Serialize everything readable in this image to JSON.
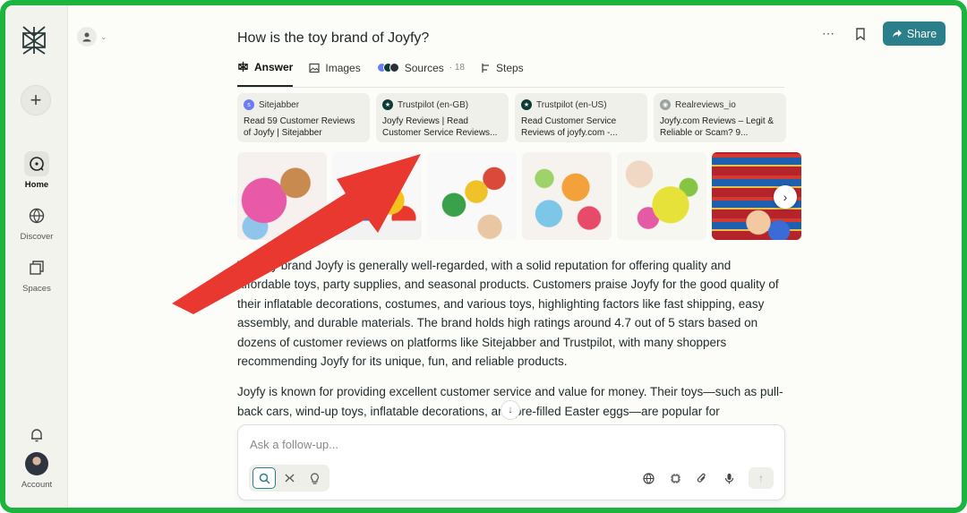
{
  "colors": {
    "frame": "#1cb33e",
    "accent": "#2a7f8a",
    "arrow": "#e8382f"
  },
  "sidebar": {
    "items": [
      {
        "label": "Home",
        "icon": "home-icon",
        "active": true
      },
      {
        "label": "Discover",
        "icon": "globe-icon",
        "active": false
      },
      {
        "label": "Spaces",
        "icon": "spaces-icon",
        "active": false
      }
    ],
    "account_label": "Account"
  },
  "header": {
    "title": "How is the toy brand of Joyfy?",
    "share_label": "Share"
  },
  "tabs": [
    {
      "label": "Answer",
      "icon": "answer-icon",
      "active": true
    },
    {
      "label": "Images",
      "icon": "image-icon",
      "active": false
    },
    {
      "label": "Sources",
      "icon": "sources-icon",
      "active": false,
      "count": "· 18"
    },
    {
      "label": "Steps",
      "icon": "steps-icon",
      "active": false
    }
  ],
  "sources": [
    {
      "site": "Sitejabber",
      "title": "Read 59 Customer Reviews of Joyfy | Sitejabber",
      "favicon": "sitejabber-icon",
      "favicon_color": "#6b7cf5"
    },
    {
      "site": "Trustpilot (en-GB)",
      "title": "Joyfy Reviews | Read Customer Service Reviews...",
      "favicon": "trustpilot-icon",
      "favicon_color": "#0b3b36"
    },
    {
      "site": "Trustpilot (en-US)",
      "title": "Read Customer Service Reviews of joyfy.com -...",
      "favicon": "trustpilot-icon",
      "favicon_color": "#0b3b36"
    },
    {
      "site": "Realreviews_io",
      "title": "Joyfy.com Reviews – Legit & Reliable or Scam? 9...",
      "favicon": "realreviews-icon",
      "favicon_color": "#9aa39e"
    }
  ],
  "answer": {
    "paragraph1": "The toy brand Joyfy is generally well-regarded, with a solid reputation for offering quality and affordable toys, party supplies, and seasonal products. Customers praise Joyfy for the good quality of their inflatable decorations, costumes, and various toys, highlighting factors like fast shipping, easy assembly, and durable materials. The brand holds high ratings around 4.7 out of 5 stars based on dozens of customer reviews on platforms like Sitejabber and Trustpilot, with many shoppers recommending Joyfy for its unique, fun, and reliable products.",
    "paragraph2": "Joyfy is known for providing excellent customer service and value for money. Their toys—such as pull-back cars, wind-up toys, inflatable decorations, and pre-filled Easter eggs—are popular for"
  },
  "followup": {
    "placeholder": "Ask a follow-up..."
  }
}
